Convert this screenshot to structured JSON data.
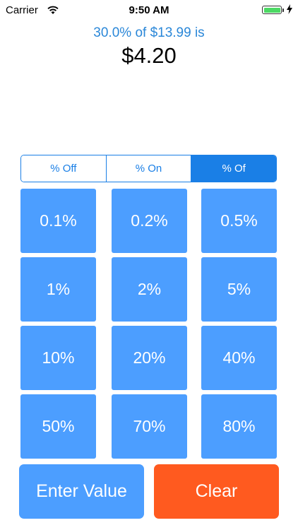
{
  "status_bar": {
    "carrier": "Carrier",
    "time": "9:50 AM",
    "wifi_icon": "wifi-icon",
    "battery_icon": "battery-icon",
    "charging_icon": "bolt-icon"
  },
  "result": {
    "description": "30.0% of $13.99 is",
    "value": "$4.20"
  },
  "modes": {
    "off": "% Off",
    "on": "% On",
    "of": "% Of",
    "selected": "% Of"
  },
  "percent_buttons": [
    "0.1%",
    "0.2%",
    "0.5%",
    "1%",
    "2%",
    "5%",
    "10%",
    "20%",
    "40%",
    "50%",
    "70%",
    "80%"
  ],
  "actions": {
    "enter_value": "Enter Value",
    "clear": "Clear"
  },
  "colors": {
    "accent": "#1a7fe6",
    "result_text": "#2a87d8",
    "button_blue": "#4c9eff",
    "clear_orange": "#ff5a1f",
    "battery_green": "#4cd964"
  }
}
